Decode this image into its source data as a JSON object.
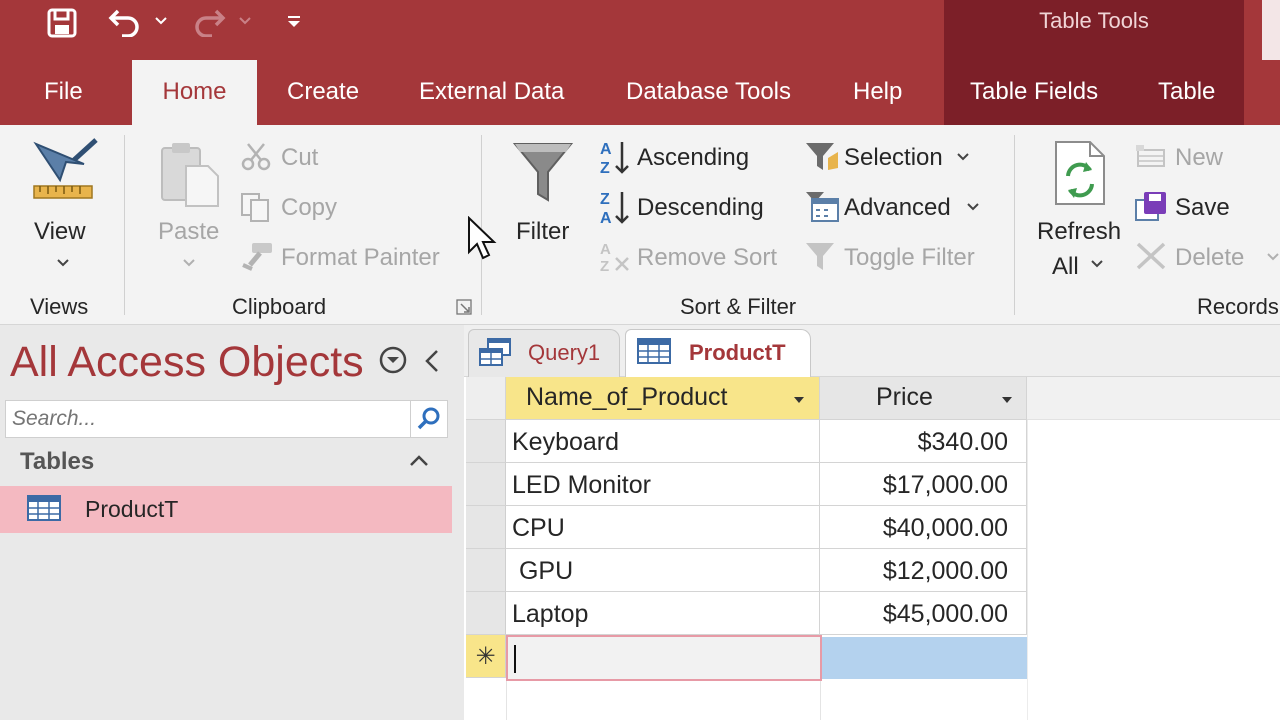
{
  "quick_access": {
    "save_icon": "save-icon",
    "undo_icon": "undo-icon",
    "redo_icon": "redo-icon",
    "customize_icon": "customize-qat-icon"
  },
  "context_title": "Table Tools",
  "tabs": {
    "file": "File",
    "home": "Home",
    "create": "Create",
    "external_data": "External Data",
    "database_tools": "Database Tools",
    "help": "Help",
    "table_fields": "Table Fields",
    "table": "Table"
  },
  "ribbon": {
    "views": {
      "view": "View",
      "group": "Views"
    },
    "clipboard": {
      "paste": "Paste",
      "cut": "Cut",
      "copy": "Copy",
      "format_painter": "Format Painter",
      "group": "Clipboard"
    },
    "sort_filter": {
      "filter": "Filter",
      "ascending": "Ascending",
      "descending": "Descending",
      "remove_sort": "Remove Sort",
      "selection": "Selection",
      "advanced": "Advanced",
      "toggle_filter": "Toggle Filter",
      "group": "Sort & Filter"
    },
    "records": {
      "refresh_line1": "Refresh",
      "refresh_line2": "All",
      "new": "New",
      "save": "Save",
      "delete": "Delete",
      "group": "Records"
    }
  },
  "nav": {
    "title": "All Access Objects",
    "search_placeholder": "Search...",
    "section": "Tables",
    "items": [
      {
        "label": "ProductT"
      }
    ]
  },
  "doc_tabs": [
    {
      "label": "Query1"
    },
    {
      "label": "ProductT"
    }
  ],
  "datasheet": {
    "columns": [
      "Name_of_Product",
      "Price"
    ],
    "rows": [
      {
        "name": "Keyboard",
        "price": "$340.00"
      },
      {
        "name": "LED Monitor",
        "price": "$17,000.00"
      },
      {
        "name": "CPU",
        "price": "$40,000.00"
      },
      {
        "name": " GPU",
        "price": "$12,000.00"
      },
      {
        "name": "Laptop",
        "price": "$45,000.00"
      }
    ],
    "new_row_marker": "✳"
  },
  "colors": {
    "brand": "#a4373a",
    "context_band": "#7c1f28",
    "selected_nav": "#f4b9c1",
    "active_header": "#f8e58a",
    "selected_cell": "#b4d2ee"
  }
}
